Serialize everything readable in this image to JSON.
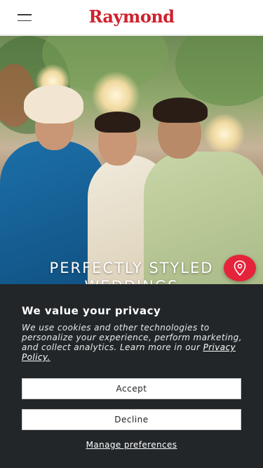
{
  "header": {
    "logo_text": "Raymond",
    "menu_icon": "hamburger-menu-icon"
  },
  "hero": {
    "headline_line1": "PERFECTLY STYLED",
    "headline_line2": "WEDDINGS",
    "locator_icon": "map-pin-icon",
    "accent_color": "#e5243b"
  },
  "cookie_banner": {
    "title": "We value your privacy",
    "body": "We use cookies and other technologies to personalize your experience, perform marketing, and collect analytics. Learn more in our ",
    "link_text": "Privacy Policy.",
    "accept_label": "Accept",
    "decline_label": "Decline",
    "manage_label": "Manage preferences",
    "background_color": "#222629"
  }
}
